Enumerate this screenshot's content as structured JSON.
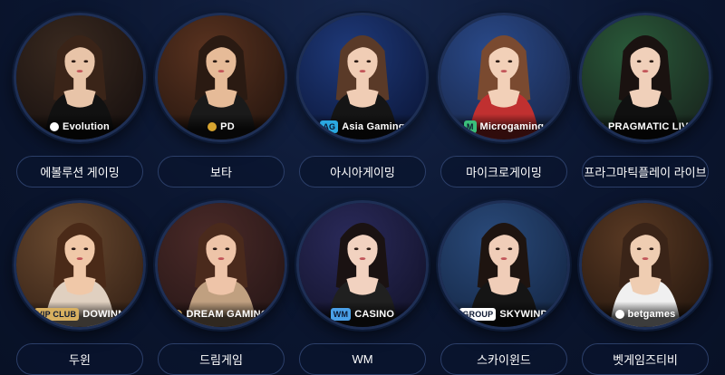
{
  "providers": [
    {
      "label": "에볼루션 게이밍",
      "logo": "Evolution",
      "logo_mark": "",
      "bg": [
        "#3a2a20",
        "#1a1210"
      ],
      "skin": "#e8c4a8",
      "hair": "#3a2418",
      "dress": "#111111",
      "accent": "#ffffff"
    },
    {
      "label": "보타",
      "logo": "PD",
      "logo_mark": "",
      "bg": [
        "#5a3320",
        "#2a1810"
      ],
      "skin": "#e6bb98",
      "hair": "#2a1a12",
      "dress": "#1a1a1a",
      "accent": "#d8a530"
    },
    {
      "label": "아시아게이밍",
      "logo": "Asia Gaming",
      "logo_mark": "AG",
      "bg": [
        "#1f3a7a",
        "#0d1a40"
      ],
      "skin": "#f0cdb5",
      "hair": "#5a3a28",
      "dress": "#151515",
      "accent": "#2aa8e0"
    },
    {
      "label": "마이크로게이밍",
      "logo": "Microgaming",
      "logo_mark": "M",
      "bg": [
        "#2a4a8a",
        "#1a2a50"
      ],
      "skin": "#f2d0b8",
      "hair": "#7a4a30",
      "dress": "#c03030",
      "accent": "#3bbf7a"
    },
    {
      "label": "프라그마틱플레이 라이브",
      "logo": "PRAGMATIC LIVE",
      "logo_mark": "",
      "bg": [
        "#2a5a3a",
        "#1a2a20"
      ],
      "skin": "#f0d0ba",
      "hair": "#1a1210",
      "dress": "#101010",
      "accent": "#f0a020"
    },
    {
      "label": "두윈",
      "logo": "DOWINN",
      "logo_mark": "VIP CLUB",
      "bg": [
        "#6a4a30",
        "#3a2518"
      ],
      "skin": "#f0c8a8",
      "hair": "#4a2a18",
      "dress": "#e0d0c0",
      "accent": "#d8b060"
    },
    {
      "label": "드림게임",
      "logo": "DREAM GAMING",
      "logo_mark": "",
      "bg": [
        "#4a2a28",
        "#2a1818"
      ],
      "skin": "#eec4a8",
      "hair": "#4a2a1c",
      "dress": "#c0a080",
      "accent": "#d8b060"
    },
    {
      "label": "WM",
      "logo": "CASINO",
      "logo_mark": "WM",
      "bg": [
        "#2a2a5a",
        "#151530"
      ],
      "skin": "#f2d2c0",
      "hair": "#1a1212",
      "dress": "#202020",
      "accent": "#4aa0e8"
    },
    {
      "label": "스카이윈드",
      "logo": "SKYWIND",
      "logo_mark": "GROUP",
      "bg": [
        "#2a4a7a",
        "#162a4a"
      ],
      "skin": "#f0cdb8",
      "hair": "#1e1410",
      "dress": "#151515",
      "accent": "#ffffff"
    },
    {
      "label": "벳게임즈티비",
      "logo": "betgames",
      "logo_mark": "",
      "bg": [
        "#5a3a24",
        "#2a1a10"
      ],
      "skin": "#efcdb2",
      "hair": "#3a2418",
      "dress": "#f0f0f0",
      "accent": "#ffffff"
    }
  ]
}
